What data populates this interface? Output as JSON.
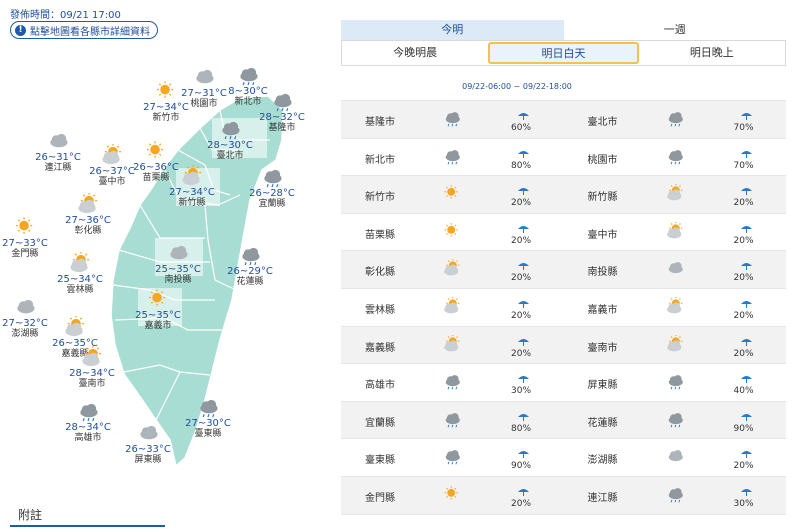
{
  "header": {
    "publish_time": "發佈時間：09/21 17:00",
    "hint": "點擊地圖看各縣市詳細資料"
  },
  "map": {
    "land_color": "#a8ddd3",
    "cities": [
      {
        "name": "新北市",
        "temp": "8~30°C",
        "icon": "cloud-rain-icon"
      },
      {
        "name": "桃園市",
        "temp": "27~31°C",
        "icon": "cloud-icon"
      },
      {
        "name": "新竹市",
        "temp": "27~34°C",
        "icon": "sun-icon"
      },
      {
        "name": "基隆市",
        "temp": "28~32°C",
        "icon": "cloud-rain-icon"
      },
      {
        "name": "臺北市",
        "temp": "28~30°C",
        "icon": "cloud-rain-icon"
      },
      {
        "name": "連江縣",
        "temp": "26~31°C",
        "icon": "cloud-icon"
      },
      {
        "name": "臺中市",
        "temp": "26~37°C",
        "icon": "sun-cloud-icon"
      },
      {
        "name": "苗栗縣",
        "temp": "26~36°C",
        "icon": "sun-icon"
      },
      {
        "name": "新竹縣",
        "temp": "27~34°C",
        "icon": "sun-cloud-icon"
      },
      {
        "name": "宜蘭縣",
        "temp": "26~28°C",
        "icon": "cloud-rain-icon"
      },
      {
        "name": "彰化縣",
        "temp": "27~36°C",
        "icon": "sun-cloud-icon"
      },
      {
        "name": "金門縣",
        "temp": "27~33°C",
        "icon": "sun-icon"
      },
      {
        "name": "南投縣",
        "temp": "25~35°C",
        "icon": "cloud-icon"
      },
      {
        "name": "花蓮縣",
        "temp": "26~29°C",
        "icon": "cloud-rain-icon"
      },
      {
        "name": "雲林縣",
        "temp": "25~34°C",
        "icon": "sun-cloud-icon"
      },
      {
        "name": "澎湖縣",
        "temp": "27~32°C",
        "icon": "cloud-icon"
      },
      {
        "name": "嘉義縣",
        "temp": "26~35°C",
        "icon": "sun-cloud-icon"
      },
      {
        "name": "嘉義市",
        "temp": "25~35°C",
        "icon": "sun-icon"
      },
      {
        "name": "臺南市",
        "temp": "28~34°C",
        "icon": "sun-cloud-icon"
      },
      {
        "name": "高雄市",
        "temp": "28~34°C",
        "icon": "cloud-rain-icon"
      },
      {
        "name": "屏東縣",
        "temp": "26~33°C",
        "icon": "cloud-icon"
      },
      {
        "name": "臺東縣",
        "temp": "27~30°C",
        "icon": "cloud-rain-icon"
      }
    ],
    "footnote": "附註"
  },
  "tabs": {
    "primary": [
      "今明",
      "一週"
    ],
    "secondary": [
      "今晚明晨",
      "明日白天",
      "明日晚上"
    ],
    "selected_secondary": 1
  },
  "time_range": "09/22-06:00 ~ 09/22-18:00",
  "table": {
    "rows": [
      [
        {
          "name": "基隆市",
          "icon": "cloud-rain-icon",
          "pop": "60%"
        },
        {
          "name": "臺北市",
          "icon": "cloud-rain-icon",
          "pop": "70%"
        }
      ],
      [
        {
          "name": "新北市",
          "icon": "cloud-rain-icon",
          "pop": "80%"
        },
        {
          "name": "桃園市",
          "icon": "cloud-rain-icon",
          "pop": "70%"
        }
      ],
      [
        {
          "name": "新竹市",
          "icon": "sun-icon",
          "pop": "20%"
        },
        {
          "name": "新竹縣",
          "icon": "sun-cloud-icon",
          "pop": "20%"
        }
      ],
      [
        {
          "name": "苗栗縣",
          "icon": "sun-icon",
          "pop": "20%"
        },
        {
          "name": "臺中市",
          "icon": "sun-cloud-icon",
          "pop": "20%"
        }
      ],
      [
        {
          "name": "彰化縣",
          "icon": "sun-cloud-icon",
          "pop": "20%"
        },
        {
          "name": "南投縣",
          "icon": "cloud-icon",
          "pop": "20%"
        }
      ],
      [
        {
          "name": "雲林縣",
          "icon": "sun-cloud-icon",
          "pop": "20%"
        },
        {
          "name": "嘉義市",
          "icon": "sun-cloud-icon",
          "pop": "20%"
        }
      ],
      [
        {
          "name": "嘉義縣",
          "icon": "sun-cloud-icon",
          "pop": "20%"
        },
        {
          "name": "臺南市",
          "icon": "sun-cloud-icon",
          "pop": "20%"
        }
      ],
      [
        {
          "name": "高雄市",
          "icon": "cloud-rain-icon",
          "pop": "30%"
        },
        {
          "name": "屏東縣",
          "icon": "cloud-rain-icon",
          "pop": "40%"
        }
      ],
      [
        {
          "name": "宜蘭縣",
          "icon": "cloud-rain-icon",
          "pop": "80%"
        },
        {
          "name": "花蓮縣",
          "icon": "cloud-rain-icon",
          "pop": "90%"
        }
      ],
      [
        {
          "name": "臺東縣",
          "icon": "cloud-rain-icon",
          "pop": "90%"
        },
        {
          "name": "澎湖縣",
          "icon": "cloud-icon",
          "pop": "20%"
        }
      ],
      [
        {
          "name": "金門縣",
          "icon": "sun-icon",
          "pop": "20%"
        },
        {
          "name": "連江縣",
          "icon": "cloud-rain-icon",
          "pop": "30%"
        }
      ]
    ]
  },
  "colors": {
    "accent": "#1f4e99",
    "tab_active_bg": "#dbeaf6",
    "selected_border": "#f2c14e",
    "sun": "#f5a623",
    "cloud": "#9aa2a8",
    "rain_drop": "#2a79c9"
  }
}
